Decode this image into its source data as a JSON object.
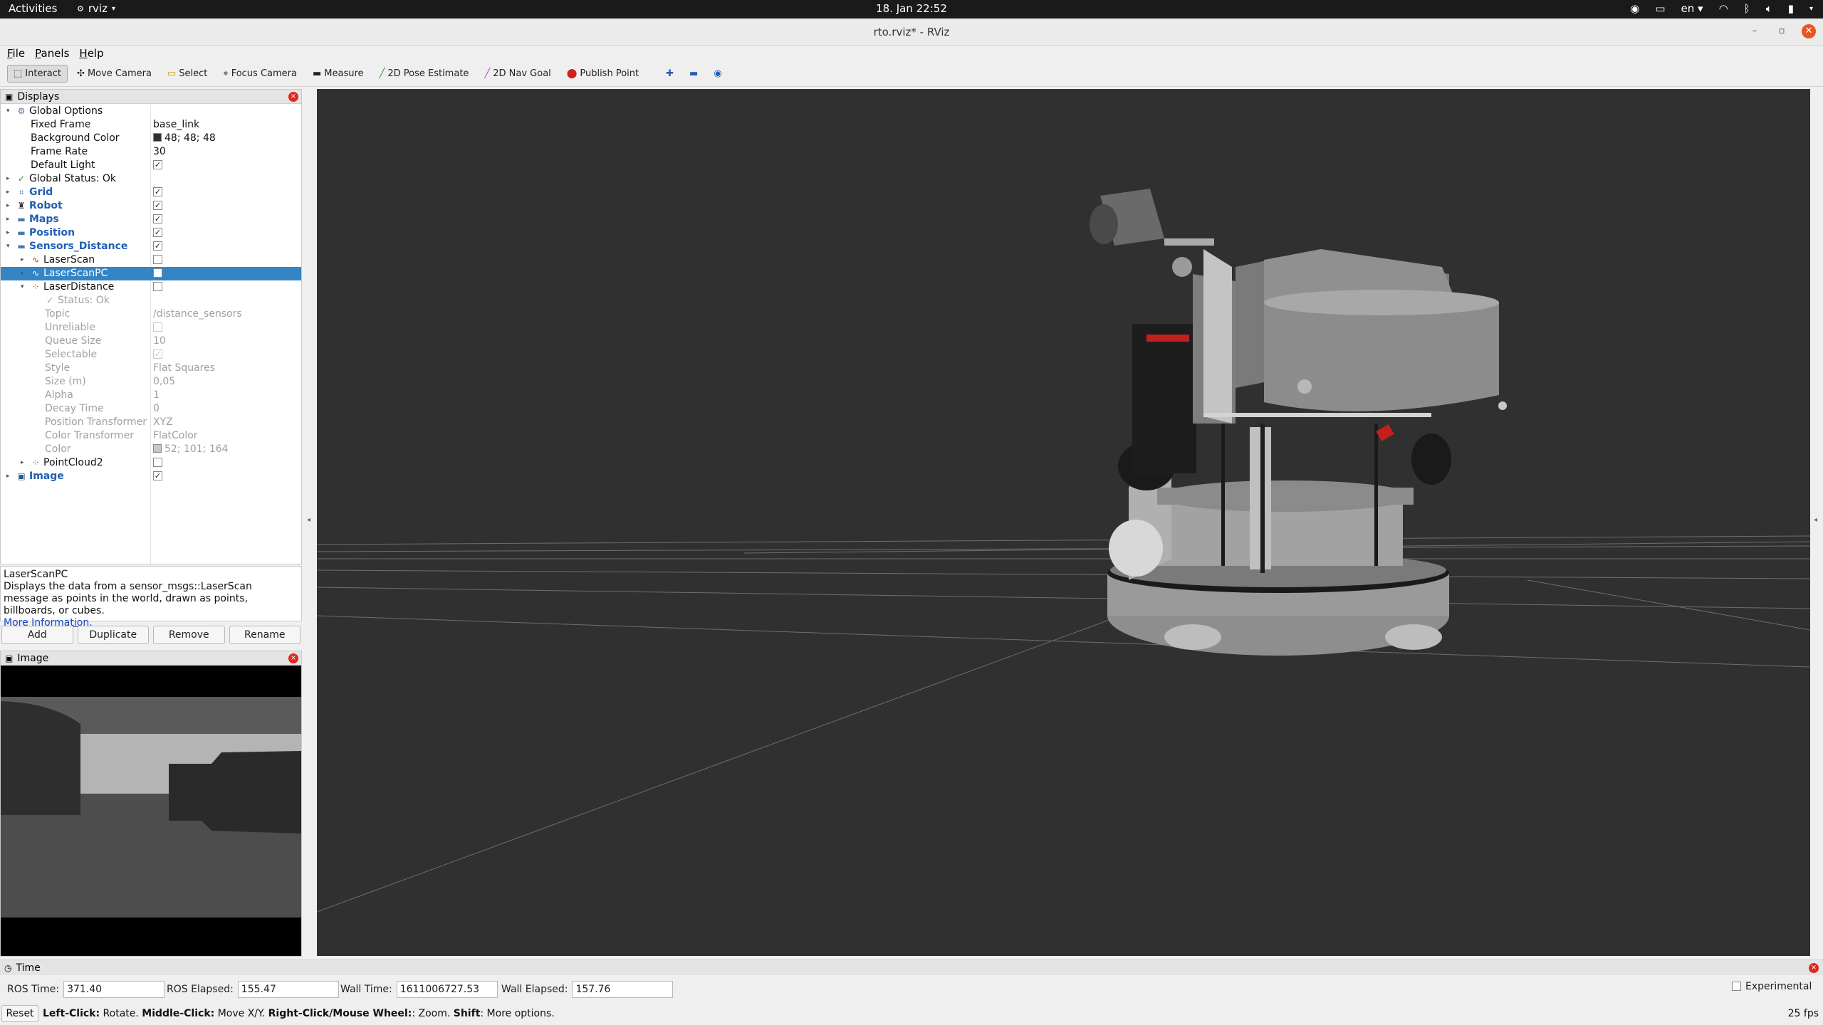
{
  "topbar": {
    "activities": "Activities",
    "app_name": "rviz",
    "clock": "18. Jan  22:52",
    "language": "en"
  },
  "window": {
    "title": "rto.rviz* - RViz"
  },
  "menu": [
    "File",
    "Panels",
    "Help"
  ],
  "toolbar": {
    "tools": [
      {
        "label": "Interact",
        "icon": "interact-icon",
        "active": true
      },
      {
        "label": "Move Camera",
        "icon": "move-camera-icon"
      },
      {
        "label": "Select",
        "icon": "select-icon"
      },
      {
        "label": "Focus Camera",
        "icon": "focus-camera-icon"
      },
      {
        "label": "Measure",
        "icon": "measure-icon"
      },
      {
        "label": "2D Pose Estimate",
        "icon": "pose-estimate-icon"
      },
      {
        "label": "2D Nav Goal",
        "icon": "nav-goal-icon"
      },
      {
        "label": "Publish Point",
        "icon": "publish-point-icon"
      }
    ]
  },
  "displays": {
    "title": "Displays",
    "rows": [
      {
        "label": "Global Options",
        "value": "",
        "depth": 0,
        "expanded": true,
        "icon": "gear-icon"
      },
      {
        "label": "Fixed Frame",
        "value": "base_link",
        "depth": 1
      },
      {
        "label": "Background Color",
        "value": "48; 48; 48",
        "depth": 1,
        "swatch": "#303030"
      },
      {
        "label": "Frame Rate",
        "value": "30",
        "depth": 1
      },
      {
        "label": "Default Light",
        "value": "",
        "depth": 1,
        "check": true
      },
      {
        "label": "Global Status: Ok",
        "value": "",
        "depth": 0,
        "collapsed": true,
        "icon": "check-icon"
      },
      {
        "label": "Grid",
        "value": "",
        "depth": 0,
        "collapsed": true,
        "icon": "grid-icon",
        "bold": true,
        "check": true
      },
      {
        "label": "Robot",
        "value": "",
        "depth": 0,
        "collapsed": true,
        "icon": "robot-icon",
        "bold": true,
        "check": true
      },
      {
        "label": "Maps",
        "value": "",
        "depth": 0,
        "collapsed": true,
        "icon": "folder-icon",
        "bold": true,
        "check": true
      },
      {
        "label": "Position",
        "value": "",
        "depth": 0,
        "collapsed": true,
        "icon": "folder-icon",
        "bold": true,
        "check": true
      },
      {
        "label": "Sensors_Distance",
        "value": "",
        "depth": 0,
        "expanded": true,
        "icon": "folder-icon",
        "bold": true,
        "check": true
      },
      {
        "label": "LaserScan",
        "value": "",
        "depth": 1,
        "collapsed": true,
        "icon": "laserscan-icon",
        "check": false
      },
      {
        "label": "LaserScanPC",
        "value": "",
        "depth": 1,
        "collapsed": true,
        "icon": "laserscan-icon",
        "check": false,
        "selected": true
      },
      {
        "label": "LaserDistance",
        "value": "",
        "depth": 1,
        "expanded": true,
        "icon": "pointcloud-icon",
        "check": false
      },
      {
        "label": "Status: Ok",
        "value": "",
        "depth": 2,
        "icon": "check-icon",
        "disabled": true
      },
      {
        "label": "Topic",
        "value": "/distance_sensors",
        "depth": 2,
        "disabled": true
      },
      {
        "label": "Unreliable",
        "value": "",
        "depth": 2,
        "disabled": true,
        "check": false
      },
      {
        "label": "Queue Size",
        "value": "10",
        "depth": 2,
        "disabled": true
      },
      {
        "label": "Selectable",
        "value": "",
        "depth": 2,
        "disabled": true,
        "check": true
      },
      {
        "label": "Style",
        "value": "Flat Squares",
        "depth": 2,
        "disabled": true
      },
      {
        "label": "Size (m)",
        "value": "0,05",
        "depth": 2,
        "disabled": true
      },
      {
        "label": "Alpha",
        "value": "1",
        "depth": 2,
        "disabled": true
      },
      {
        "label": "Decay Time",
        "value": "0",
        "depth": 2,
        "disabled": true
      },
      {
        "label": "Position Transformer",
        "value": "XYZ",
        "depth": 2,
        "disabled": true
      },
      {
        "label": "Color Transformer",
        "value": "FlatColor",
        "depth": 2,
        "disabled": true
      },
      {
        "label": "Color",
        "value": "52; 101; 164",
        "depth": 2,
        "disabled": true,
        "swatch": "#c8c8c8"
      },
      {
        "label": "PointCloud2",
        "value": "",
        "depth": 1,
        "collapsed": true,
        "icon": "pointcloud-icon",
        "check": false
      },
      {
        "label": "Image",
        "value": "",
        "depth": 0,
        "collapsed": true,
        "icon": "image-icon",
        "bold": true,
        "check": true
      }
    ]
  },
  "description": {
    "title": "LaserScanPC",
    "text": "Displays the data from a sensor_msgs::LaserScan message as points in the world, drawn as points, billboards, or cubes.",
    "link": "More Information."
  },
  "buttons": [
    "Add",
    "Duplicate",
    "Remove",
    "Rename"
  ],
  "image_panel": {
    "title": "Image"
  },
  "time_panel": {
    "title": "Time",
    "ros_time_label": "ROS Time:",
    "ros_time": "371.40",
    "ros_elapsed_label": "ROS Elapsed:",
    "ros_elapsed": "155.47",
    "wall_time_label": "Wall Time:",
    "wall_time": "1611006727.53",
    "wall_elapsed_label": "Wall Elapsed:",
    "wall_elapsed": "157.76",
    "experimental": "Experimental"
  },
  "status": {
    "reset": "Reset",
    "hint_left_key": "Left-Click:",
    "hint_left": " Rotate. ",
    "hint_middle_key": "Middle-Click:",
    "hint_middle": " Move X/Y. ",
    "hint_right_key": "Right-Click/Mouse Wheel:",
    "hint_right": ": Zoom. ",
    "hint_shift_key": "Shift",
    "hint_shift": ": More options.",
    "fps": "25 fps"
  },
  "colors": {
    "viewport_bg": "#303030",
    "selection": "#3584c4",
    "display_group_text": "#1f5fb4"
  }
}
